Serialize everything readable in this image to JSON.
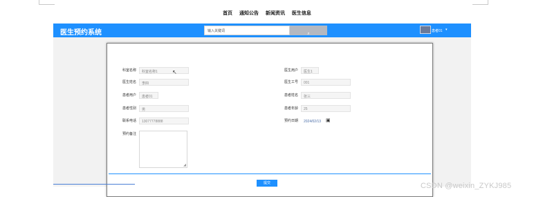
{
  "frame": {
    "text": ""
  },
  "nav": {
    "items": [
      "首页",
      "通知公告",
      "新闻资讯",
      "医生信息"
    ]
  },
  "header": {
    "brand": "医生预约系统",
    "search_placeholder": "输入关键词",
    "username": "患者01",
    "chevron": "▾",
    "colors": {
      "header_bg": "#1e90ff"
    }
  },
  "form": {
    "fields": {
      "dept_name": {
        "label": "科室名称",
        "value": "科室名称1"
      },
      "doctor_name": {
        "label": "医生姓名",
        "value": "李四"
      },
      "patient_user": {
        "label": "患者用户",
        "value": "患者01"
      },
      "patient_gender": {
        "label": "患者性别",
        "value": "男"
      },
      "contact_phone": {
        "label": "联系电话",
        "value": "13077778888"
      },
      "doctor_user": {
        "label": "医生用户",
        "value": "医生1"
      },
      "doctor_id": {
        "label": "医生工号",
        "value": "001"
      },
      "patient_name": {
        "label": "患者姓名",
        "value": "张三"
      },
      "patient_age": {
        "label": "患者年龄",
        "value": "25"
      },
      "appointment_date": {
        "label": "预约日期",
        "value": "2024/02/13"
      },
      "note": {
        "label": "预约备注",
        "value": ""
      }
    },
    "submit_label": "提交"
  },
  "watermark": "CSDN @weixin_ZYKJ985"
}
